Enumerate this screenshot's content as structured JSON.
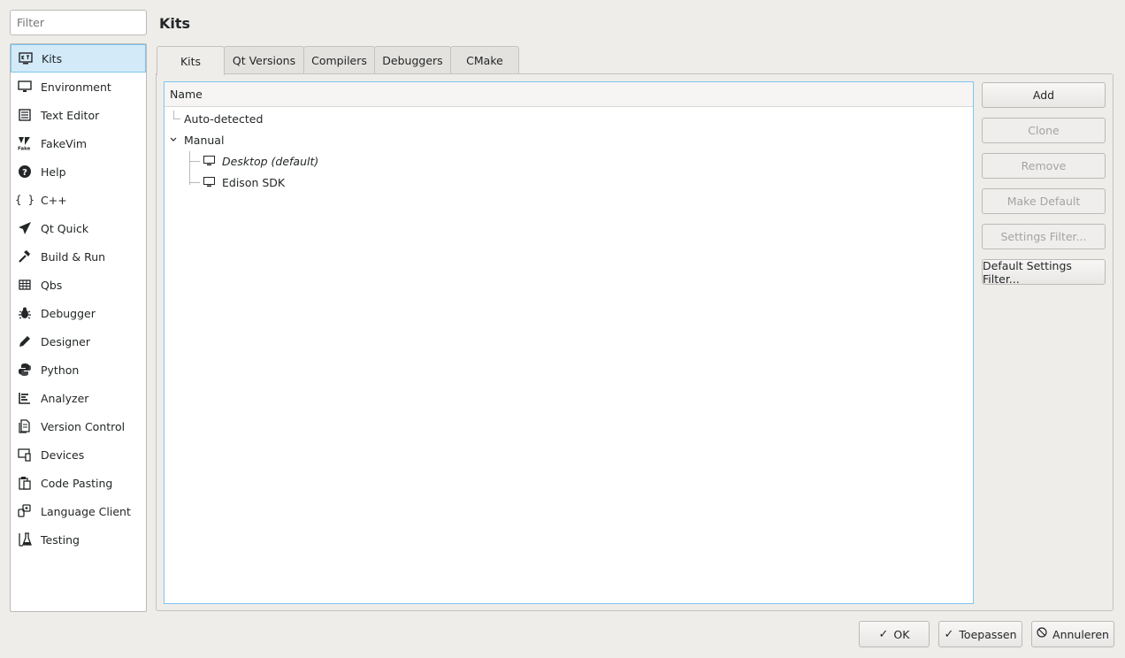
{
  "filter": {
    "placeholder": "Filter"
  },
  "categories": [
    {
      "label": "Kits",
      "icon": "kits-icon"
    },
    {
      "label": "Environment",
      "icon": "monitor-icon"
    },
    {
      "label": "Text Editor",
      "icon": "text-editor-icon"
    },
    {
      "label": "FakeVim",
      "icon": "fakevim-icon"
    },
    {
      "label": "Help",
      "icon": "help-icon"
    },
    {
      "label": "C++",
      "icon": "braces-icon"
    },
    {
      "label": "Qt Quick",
      "icon": "paper-plane-icon"
    },
    {
      "label": "Build & Run",
      "icon": "hammer-icon"
    },
    {
      "label": "Qbs",
      "icon": "qbs-icon"
    },
    {
      "label": "Debugger",
      "icon": "bug-icon"
    },
    {
      "label": "Designer",
      "icon": "pencil-icon"
    },
    {
      "label": "Python",
      "icon": "python-icon"
    },
    {
      "label": "Analyzer",
      "icon": "analyzer-icon"
    },
    {
      "label": "Version Control",
      "icon": "version-control-icon"
    },
    {
      "label": "Devices",
      "icon": "devices-icon"
    },
    {
      "label": "Code Pasting",
      "icon": "clipboard-icon"
    },
    {
      "label": "Language Client",
      "icon": "language-client-icon"
    },
    {
      "label": "Testing",
      "icon": "flask-icon"
    }
  ],
  "page": {
    "title": "Kits"
  },
  "tabs": [
    {
      "label": "Kits"
    },
    {
      "label": "Qt Versions"
    },
    {
      "label": "Compilers"
    },
    {
      "label": "Debuggers"
    },
    {
      "label": "CMake"
    }
  ],
  "tree": {
    "header": "Name",
    "auto_detected": "Auto-detected",
    "manual": "Manual",
    "kits": [
      {
        "label": "Desktop (default)"
      },
      {
        "label": "Edison SDK"
      }
    ]
  },
  "side_buttons": {
    "add": "Add",
    "clone": "Clone",
    "remove": "Remove",
    "make_default": "Make Default",
    "settings_filter": "Settings Filter...",
    "default_settings_filter": "Default Settings Filter..."
  },
  "bottom_buttons": {
    "ok": "OK",
    "apply": "Toepassen",
    "cancel": "Annuleren"
  }
}
